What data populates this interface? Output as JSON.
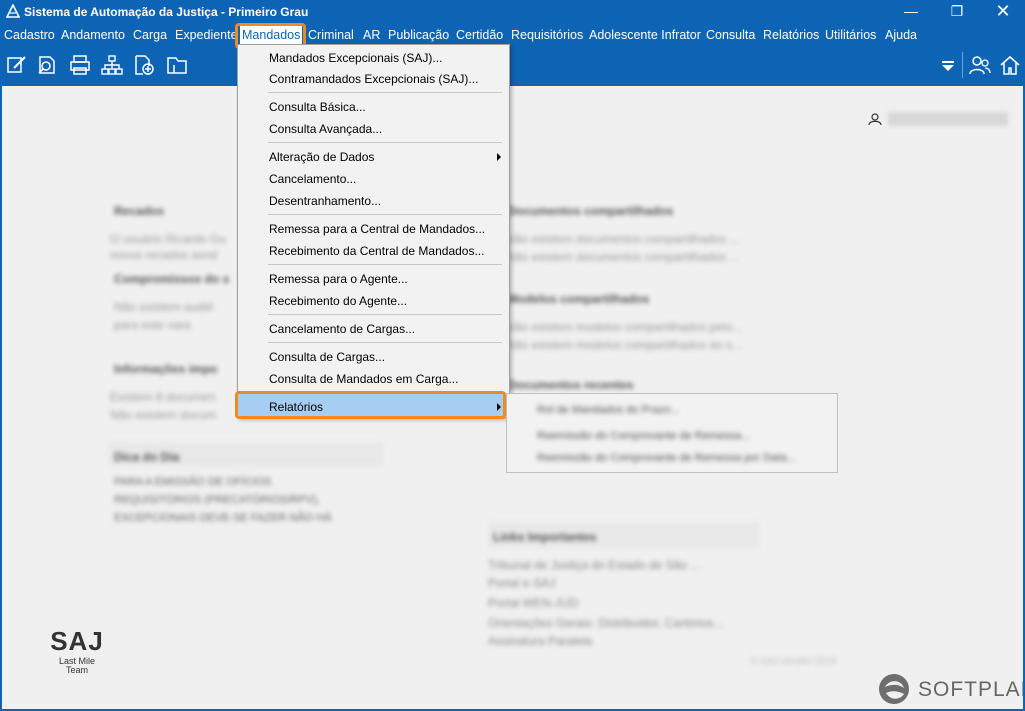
{
  "window": {
    "title": "Sistema de Automação da Justiça - Primeiro Grau",
    "minimize_glyph": "—",
    "maximize_glyph": "❐",
    "close_glyph": "✕"
  },
  "menubar": {
    "items": [
      {
        "label": "Cadastro"
      },
      {
        "label": "Andamento"
      },
      {
        "label": "Carga"
      },
      {
        "label": "Expediente"
      },
      {
        "label": "Mandados",
        "active": true
      },
      {
        "label": "Criminal"
      },
      {
        "label": "AR"
      },
      {
        "label": "Publicação"
      },
      {
        "label": "Certidão"
      },
      {
        "label": "Requisitórios"
      },
      {
        "label": "Adolescente Infrator"
      },
      {
        "label": "Consulta"
      },
      {
        "label": "Relatórios"
      },
      {
        "label": "Utilitários"
      },
      {
        "label": "Ajuda"
      }
    ]
  },
  "toolbar": {
    "icons": [
      "edit-icon",
      "search-document-icon",
      "printer-icon",
      "org-chart-icon",
      "add-file-icon",
      "folder-icon",
      "dropdown-triangle-icon",
      "users-icon",
      "home-icon"
    ]
  },
  "dropdown": {
    "items": [
      {
        "label": "Mandados Excepcionais (SAJ)..."
      },
      {
        "label": "Contramandados Excepcionais (SAJ)..."
      },
      {
        "label": "Consulta Básica..."
      },
      {
        "label": "Consulta Avançada..."
      },
      {
        "label": "Alteração de Dados",
        "submenu": true
      },
      {
        "label": "Cancelamento..."
      },
      {
        "label": "Desentranhamento..."
      },
      {
        "label": "Remessa para a Central de Mandados..."
      },
      {
        "label": "Recebimento da Central de Mandados..."
      },
      {
        "label": "Remessa para o Agente..."
      },
      {
        "label": "Recebimento do Agente..."
      },
      {
        "label": "Cancelamento de Cargas..."
      },
      {
        "label": "Consulta de Cargas..."
      },
      {
        "label": "Consulta de Mandados em Carga..."
      },
      {
        "label": "Relatórios",
        "submenu": true,
        "highlighted": true
      }
    ]
  },
  "submenu": {
    "items": [
      {
        "label": "Rol de Mandados do Prazo..."
      },
      {
        "label": "Reemissão do Comprovante de Remessa..."
      },
      {
        "label": "Reemissão do Comprovante de Remessa por Data..."
      }
    ]
  },
  "panels": {
    "recados_title": "Recados",
    "recados_text1": "O usuário Ricardo Gu",
    "recados_text2": "novos recados send",
    "compromissos_title": "Compromissos do s",
    "compromissos_text1": "Não existem audiê",
    "compromissos_text2": "para este vara",
    "info_title": "Informações impo",
    "info_text1": "Existem 8 documen",
    "info_text2": "Não existem docum",
    "dica_title": "Dica do Dia",
    "dica_text1": "PARA A EMISSÃO DE OFÍCIOS",
    "dica_text2": "REQUISITÓRIOS (PRECATÓRIOS/RPV),",
    "dica_text3": "EXCEPCIONAIS DEVE-SE FAZER NÃO HÁ",
    "docs_title": "Documentos compartilhados",
    "docs_text1": "Não existem documentos compartilhados ...",
    "docs_text2": "Não existem documentos compartilhados ...",
    "modelos_title": "Modelos compartilhados",
    "modelos_text1": "Não existem modelos compartilhados pelo...",
    "modelos_text2": "Não existem modelos compartilhados ao s...",
    "recentes_title": "Documentos recentes",
    "links_title": "Links Importantes",
    "links": [
      "Tribunal de Justiça do Estado de São ...",
      "Portal e-SAJ",
      "Portal WEN-JUD",
      "Orientações Gerais: Distribuidor, Cartórios...",
      "Assinatura Paralela"
    ],
    "footer_text": "© SAJ versão 2024"
  },
  "user": {
    "name": "Nome do usuário"
  },
  "branding": {
    "saj_mark": "SAJ",
    "saj_sub1": "Last Mile",
    "saj_sub2": "Team",
    "softplan": "SOFTPLAN"
  }
}
